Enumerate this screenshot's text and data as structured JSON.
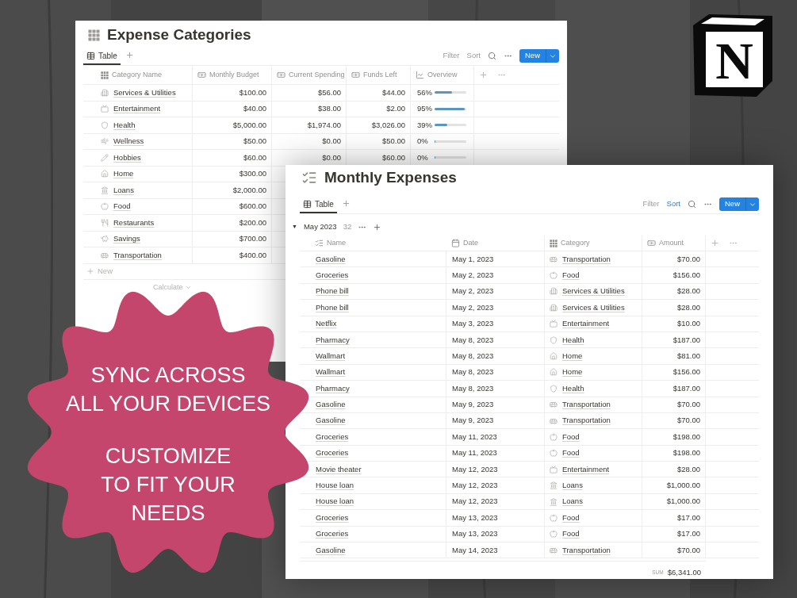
{
  "logo": {
    "letter": "N"
  },
  "categories_window": {
    "title": "Expense Categories",
    "views": [
      {
        "label": "Table",
        "selected": true
      }
    ],
    "toolbar": {
      "filter": "Filter",
      "sort": "Sort",
      "sort_active": false,
      "new": "New"
    },
    "columns": [
      {
        "label": "Category Name",
        "kind": "grid"
      },
      {
        "label": "Monthly Budget",
        "kind": "money"
      },
      {
        "label": "Current Spending",
        "kind": "money"
      },
      {
        "label": "Funds Left",
        "kind": "money"
      },
      {
        "label": "Overview",
        "kind": "chart"
      }
    ],
    "rows": [
      {
        "name": "Services & Utilities",
        "kind": "utilities",
        "budget": "$100.00",
        "spending": "$56.00",
        "funds": "$44.00",
        "percent": "56%",
        "level": 0.56
      },
      {
        "name": "Entertainment",
        "kind": "entertainment",
        "budget": "$40.00",
        "spending": "$38.00",
        "funds": "$2.00",
        "percent": "95%",
        "level": 0.95
      },
      {
        "name": "Health",
        "kind": "health",
        "budget": "$5,000.00",
        "spending": "$1,974.00",
        "funds": "$3,026.00",
        "percent": "39%",
        "level": 0.39
      },
      {
        "name": "Wellness",
        "kind": "wellness",
        "budget": "$50.00",
        "spending": "$0.00",
        "funds": "$50.00",
        "percent": "0%",
        "level": 0
      },
      {
        "name": "Hobbies",
        "kind": "hobbies",
        "budget": "$60.00",
        "spending": "$0.00",
        "funds": "$60.00",
        "percent": "0%",
        "level": 0
      },
      {
        "name": "Home",
        "kind": "home",
        "budget": "$300.00"
      },
      {
        "name": "Loans",
        "kind": "loans",
        "budget": "$2,000.00"
      },
      {
        "name": "Food",
        "kind": "food",
        "budget": "$600.00"
      },
      {
        "name": "Restaurants",
        "kind": "restaurants",
        "budget": "$200.00"
      },
      {
        "name": "Savings",
        "kind": "savings",
        "budget": "$700.00"
      },
      {
        "name": "Transportation",
        "kind": "transportation",
        "budget": "$400.00"
      }
    ],
    "new_row": "New",
    "calculate": "Calculate"
  },
  "expenses_window": {
    "title": "Monthly Expenses",
    "views": [
      {
        "label": "Table",
        "selected": true
      }
    ],
    "toolbar": {
      "filter": "Filter",
      "sort": "Sort",
      "sort_active": true,
      "new": "New"
    },
    "group": {
      "toggle": "▼",
      "expanded": true,
      "label": "May 2023",
      "count": "32"
    },
    "columns": [
      {
        "label": "Name",
        "kind": "checklist"
      },
      {
        "label": "Date",
        "kind": "calendar"
      },
      {
        "label": "Category",
        "kind": "grid"
      },
      {
        "label": "Amount",
        "kind": "money"
      }
    ],
    "rows": [
      {
        "name": "Gasoline",
        "date": "May 1, 2023",
        "category": "Transportation",
        "kind": "transportation",
        "amount": "$70.00"
      },
      {
        "name": "Groceries",
        "date": "May 2, 2023",
        "category": "Food",
        "kind": "food",
        "amount": "$156.00"
      },
      {
        "name": "Phone bill",
        "date": "May 2, 2023",
        "category": "Services & Utilities",
        "kind": "utilities",
        "amount": "$28.00"
      },
      {
        "name": "Phone bill",
        "date": "May 2, 2023",
        "category": "Services & Utilities",
        "kind": "utilities",
        "amount": "$28.00"
      },
      {
        "name": "Netflix",
        "date": "May 3, 2023",
        "category": "Entertainment",
        "kind": "entertainment",
        "amount": "$10.00"
      },
      {
        "name": "Pharmacy",
        "date": "May 8, 2023",
        "category": "Health",
        "kind": "health",
        "amount": "$187.00"
      },
      {
        "name": "Wallmart",
        "date": "May 8, 2023",
        "category": "Home",
        "kind": "home",
        "amount": "$81.00"
      },
      {
        "name": "Wallmart",
        "date": "May 8, 2023",
        "category": "Home",
        "kind": "home",
        "amount": "$156.00"
      },
      {
        "name": "Pharmacy",
        "date": "May 8, 2023",
        "category": "Health",
        "kind": "health",
        "amount": "$187.00"
      },
      {
        "name": "Gasoline",
        "date": "May 9, 2023",
        "category": "Transportation",
        "kind": "transportation",
        "amount": "$70.00"
      },
      {
        "name": "Gasoline",
        "date": "May 9, 2023",
        "category": "Transportation",
        "kind": "transportation",
        "amount": "$70.00"
      },
      {
        "name": "Groceries",
        "date": "May 11, 2023",
        "category": "Food",
        "kind": "food",
        "amount": "$198.00"
      },
      {
        "name": "Groceries",
        "date": "May 11, 2023",
        "category": "Food",
        "kind": "food",
        "amount": "$198.00"
      },
      {
        "name": "Movie theater",
        "date": "May 12, 2023",
        "category": "Entertainment",
        "kind": "entertainment",
        "amount": "$28.00"
      },
      {
        "name": "House loan",
        "date": "May 12, 2023",
        "category": "Loans",
        "kind": "loans",
        "amount": "$1,000.00"
      },
      {
        "name": "House loan",
        "date": "May 12, 2023",
        "category": "Loans",
        "kind": "loans",
        "amount": "$1,000.00"
      },
      {
        "name": "Groceries",
        "date": "May 13, 2023",
        "category": "Food",
        "kind": "food",
        "amount": "$17.00"
      },
      {
        "name": "Groceries",
        "date": "May 13, 2023",
        "category": "Food",
        "kind": "food",
        "amount": "$17.00"
      },
      {
        "name": "Gasoline",
        "date": "May 14, 2023",
        "category": "Transportation",
        "kind": "transportation",
        "amount": "$70.00"
      }
    ],
    "sum": {
      "label": "SUM",
      "value": "$6,341.00"
    }
  },
  "badge": {
    "paragraphs": [
      [
        "SYNC ACROSS",
        "ALL YOUR DEVICES"
      ],
      [
        "CUSTOMIZE",
        "TO FIT YOUR",
        "NEEDS"
      ]
    ]
  }
}
